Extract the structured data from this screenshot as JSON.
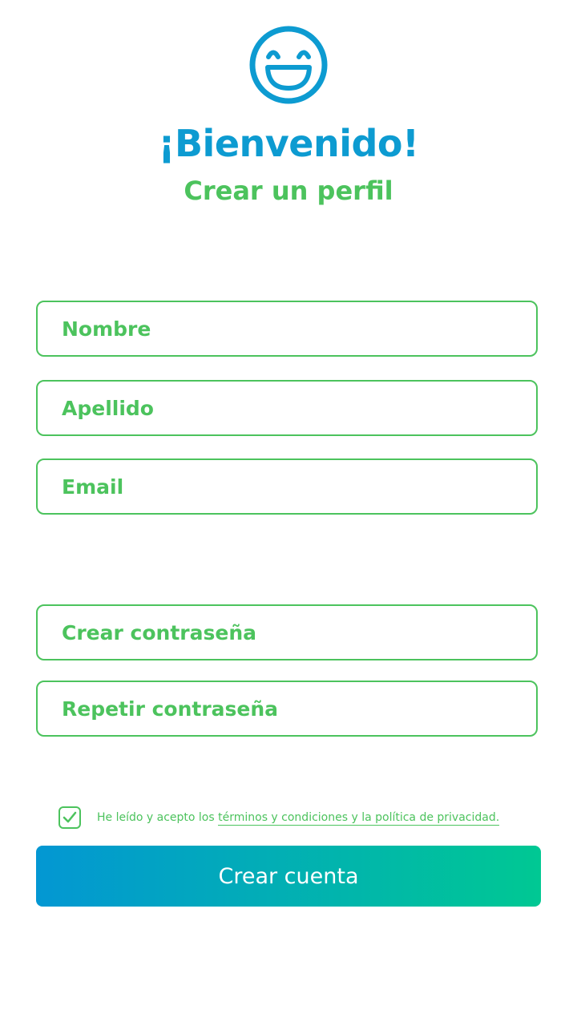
{
  "header": {
    "logo_icon": "smiley-face-icon",
    "title": "¡Bienvenido!",
    "subtitle": "Crear un perfil"
  },
  "form": {
    "first_name": {
      "value": "",
      "placeholder": "Nombre"
    },
    "last_name": {
      "value": "",
      "placeholder": "Apellido"
    },
    "email": {
      "value": "",
      "placeholder": "Email"
    },
    "password": {
      "value": "",
      "placeholder": "Crear contraseña"
    },
    "password_repeat": {
      "value": "",
      "placeholder": "Repetir contraseña"
    }
  },
  "terms": {
    "checked": true,
    "checkbox_icon": "checkmark-icon",
    "prefix": "He leído y acepto los ",
    "link_text": "términos y condiciones y la política de privacidad."
  },
  "submit": {
    "label": "Crear cuenta"
  },
  "colors": {
    "primary_blue": "#0d9bd1",
    "primary_green": "#4cc35d",
    "gradient_start": "#0397d3",
    "gradient_end": "#00c893"
  }
}
